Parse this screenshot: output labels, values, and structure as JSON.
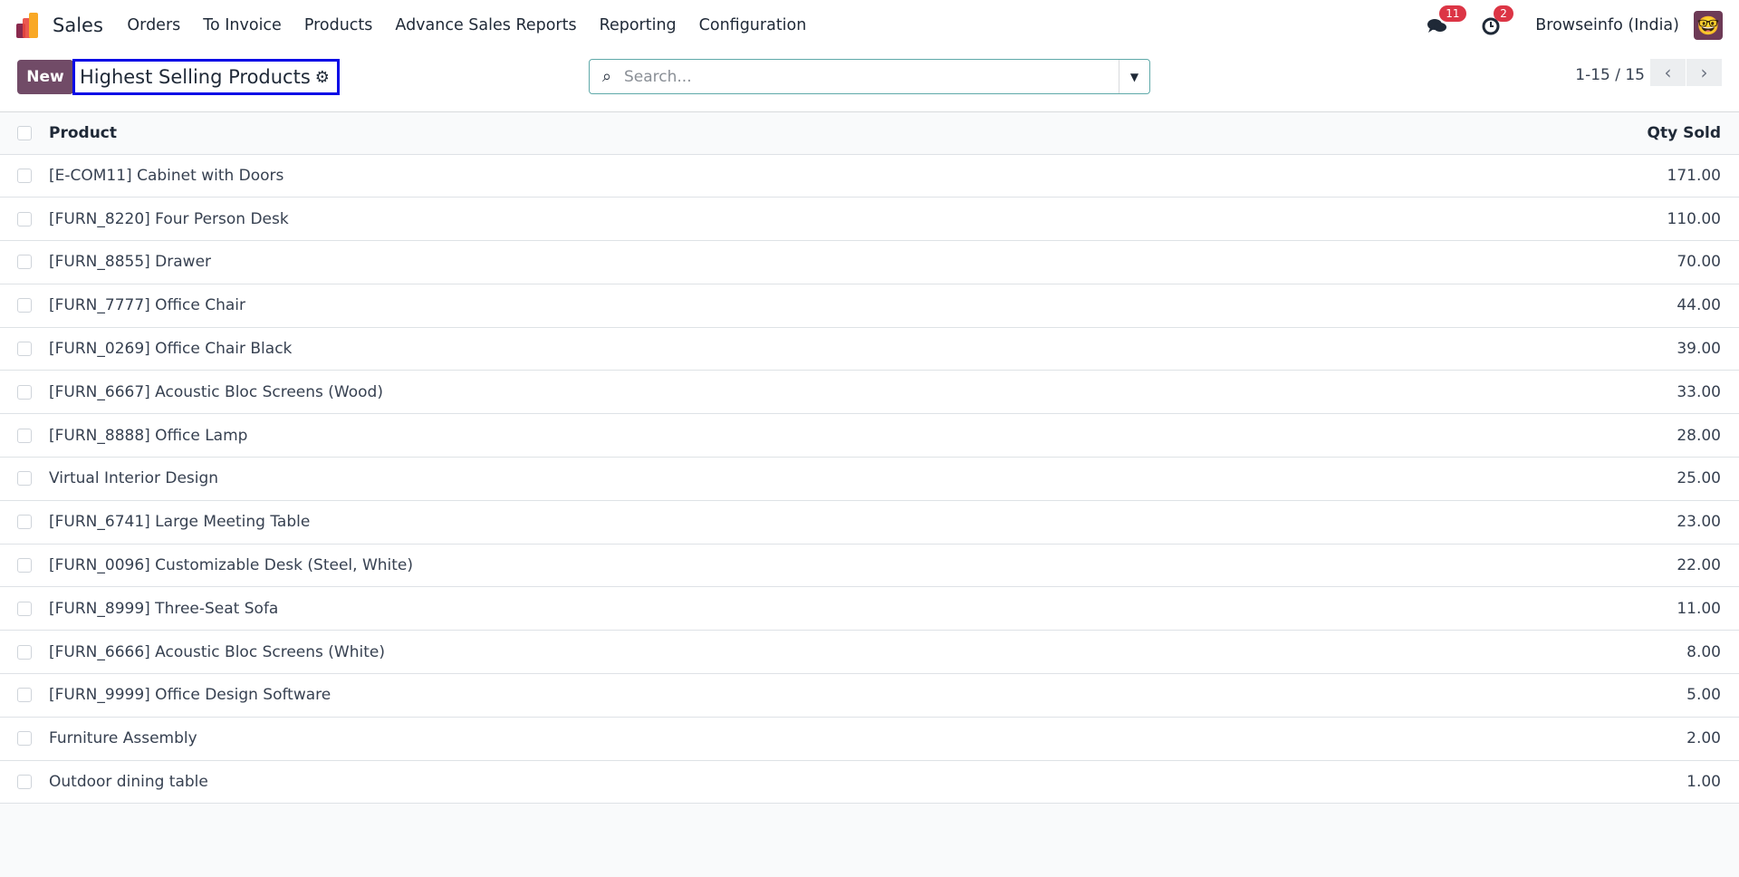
{
  "navbar": {
    "app": "Sales",
    "menu": [
      "Orders",
      "To Invoice",
      "Products",
      "Advance Sales Reports",
      "Reporting",
      "Configuration"
    ],
    "messages_count": "11",
    "activities_count": "2",
    "user": "Browseinfo (India)"
  },
  "control_panel": {
    "new_label": "New",
    "title": "Highest Selling Products",
    "search_placeholder": "Search...",
    "pager": "1-15 / 15"
  },
  "table": {
    "columns": [
      "Product",
      "Qty Sold"
    ],
    "rows": [
      [
        "[E-COM11] Cabinet with Doors",
        "171.00"
      ],
      [
        "[FURN_8220] Four Person Desk",
        "110.00"
      ],
      [
        "[FURN_8855] Drawer",
        "70.00"
      ],
      [
        "[FURN_7777] Office Chair",
        "44.00"
      ],
      [
        "[FURN_0269] Office Chair Black",
        "39.00"
      ],
      [
        "[FURN_6667] Acoustic Bloc Screens (Wood)",
        "33.00"
      ],
      [
        "[FURN_8888] Office Lamp",
        "28.00"
      ],
      [
        "Virtual Interior Design",
        "25.00"
      ],
      [
        "[FURN_6741] Large Meeting Table",
        "23.00"
      ],
      [
        "[FURN_0096] Customizable Desk (Steel, White)",
        "22.00"
      ],
      [
        "[FURN_8999] Three-Seat Sofa",
        "11.00"
      ],
      [
        "[FURN_6666] Acoustic Bloc Screens (White)",
        "8.00"
      ],
      [
        "[FURN_9999] Office Design Software",
        "5.00"
      ],
      [
        "Furniture Assembly",
        "2.00"
      ],
      [
        "Outdoor dining table",
        "1.00"
      ]
    ]
  }
}
